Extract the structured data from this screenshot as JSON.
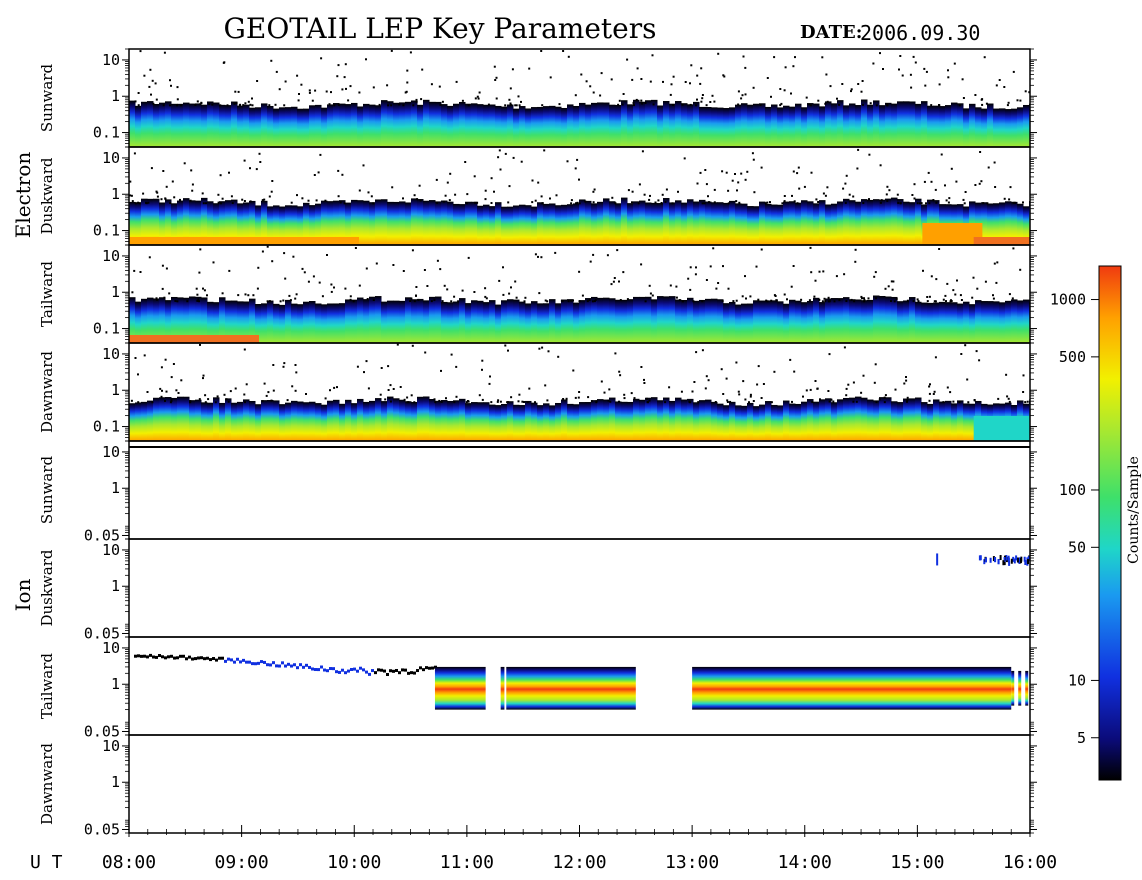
{
  "title": "GEOTAIL LEP Key Parameters",
  "date_label": "DATE:",
  "date_value": "2006.09.30",
  "ut_label": "U T",
  "time_ticks": [
    "08:00",
    "09:00",
    "10:00",
    "11:00",
    "12:00",
    "13:00",
    "14:00",
    "15:00",
    "16:00"
  ],
  "groups": {
    "electron": "Electron",
    "ion": "Ion"
  },
  "colorbar": {
    "label": "Counts/Sample",
    "scale": "log",
    "range": [
      3,
      1500
    ],
    "ticks": [
      "5",
      "10",
      "50",
      "100",
      "500",
      "1000"
    ],
    "tick_values": [
      5,
      10,
      50,
      100,
      500,
      1000
    ]
  },
  "colors": {
    "frame": "#000000",
    "background": "#ffffff",
    "colormap": [
      "#000000",
      "#0b0b7a",
      "#1030e0",
      "#1a9af0",
      "#1fd6c8",
      "#3ee06a",
      "#a8e830",
      "#f2f000",
      "#ffa000",
      "#f03a10"
    ]
  },
  "chart_data": {
    "type": "heatmap",
    "x_range": [
      "08:00",
      "16:00"
    ],
    "y_scale": "log",
    "panels": [
      {
        "group": "Electron",
        "direction": "Sunward",
        "yticks": [
          "10",
          "1",
          "0.1"
        ],
        "ylim": [
          0.04,
          20
        ],
        "upper_edge": 0.6,
        "bottom_color": "green"
      },
      {
        "group": "Electron",
        "direction": "Duskward",
        "yticks": [
          "10",
          "1",
          "0.1"
        ],
        "ylim": [
          0.04,
          20
        ],
        "upper_edge": 0.6,
        "bottom_color": "yellow-orange"
      },
      {
        "group": "Electron",
        "direction": "Tailward",
        "yticks": [
          "10",
          "1",
          "0.1"
        ],
        "ylim": [
          0.04,
          20
        ],
        "upper_edge": 0.6,
        "bottom_color": "orange before 09:00"
      },
      {
        "group": "Electron",
        "direction": "Dawnward",
        "yticks": [
          "10",
          "1",
          "0.1"
        ],
        "ylim": [
          0.04,
          20
        ],
        "upper_edge": 0.5,
        "bottom_color": "yellow"
      },
      {
        "group": "Ion",
        "direction": "Sunward",
        "yticks": [
          "10",
          "1",
          "0.05"
        ],
        "ylim": [
          0.04,
          20
        ],
        "signal": "none"
      },
      {
        "group": "Ion",
        "direction": "Duskward",
        "yticks": [
          "10",
          "1",
          "0.05"
        ],
        "ylim": [
          0.04,
          20
        ],
        "signal": "sparse blue after 15:10"
      },
      {
        "group": "Ion",
        "direction": "Tailward",
        "yticks": [
          "10",
          "1",
          "0.05"
        ],
        "ylim": [
          0.04,
          20
        ],
        "signal": "band 0.2-3 from 10:43 to 15:50, gap 12:30-13:00"
      },
      {
        "group": "Ion",
        "direction": "Dawnward",
        "yticks": [
          "10",
          "1",
          "0.05"
        ],
        "ylim": [
          0.04,
          20
        ],
        "signal": "none"
      }
    ]
  }
}
